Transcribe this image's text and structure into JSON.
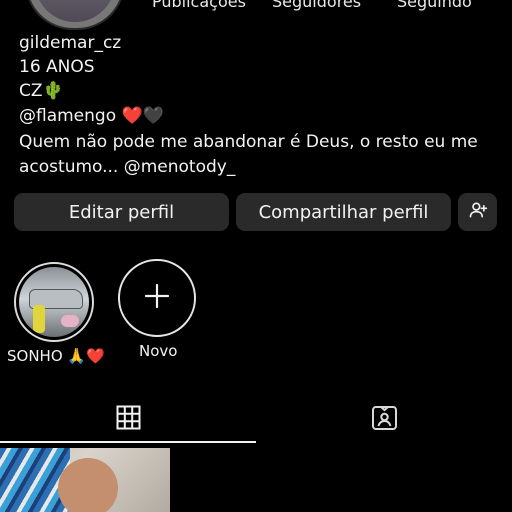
{
  "profile": {
    "stats": [
      "Publicações",
      "Seguidores",
      "Seguindo"
    ],
    "bio": [
      "gildemar_cz",
      "16 ANOS",
      "CZ🌵",
      "@flamengo ❤️🖤",
      "Quem não pode me abandonar é Deus, o resto eu me",
      "acostumo... @menotody_"
    ]
  },
  "actions": {
    "edit_label": "Editar perfil",
    "share_label": "Compartilhar perfil",
    "discover_icon": "add-person-icon"
  },
  "highlights": [
    {
      "label": "SONHO 🙏❤️"
    },
    {
      "label": "Novo",
      "icon": "plus-icon"
    }
  ],
  "tabs": [
    {
      "icon": "grid-icon",
      "active": true
    },
    {
      "icon": "tagged-icon",
      "active": false
    }
  ],
  "colors": {
    "background": "#000000",
    "button": "#2a2a2a",
    "text": "#f2f2f2"
  }
}
